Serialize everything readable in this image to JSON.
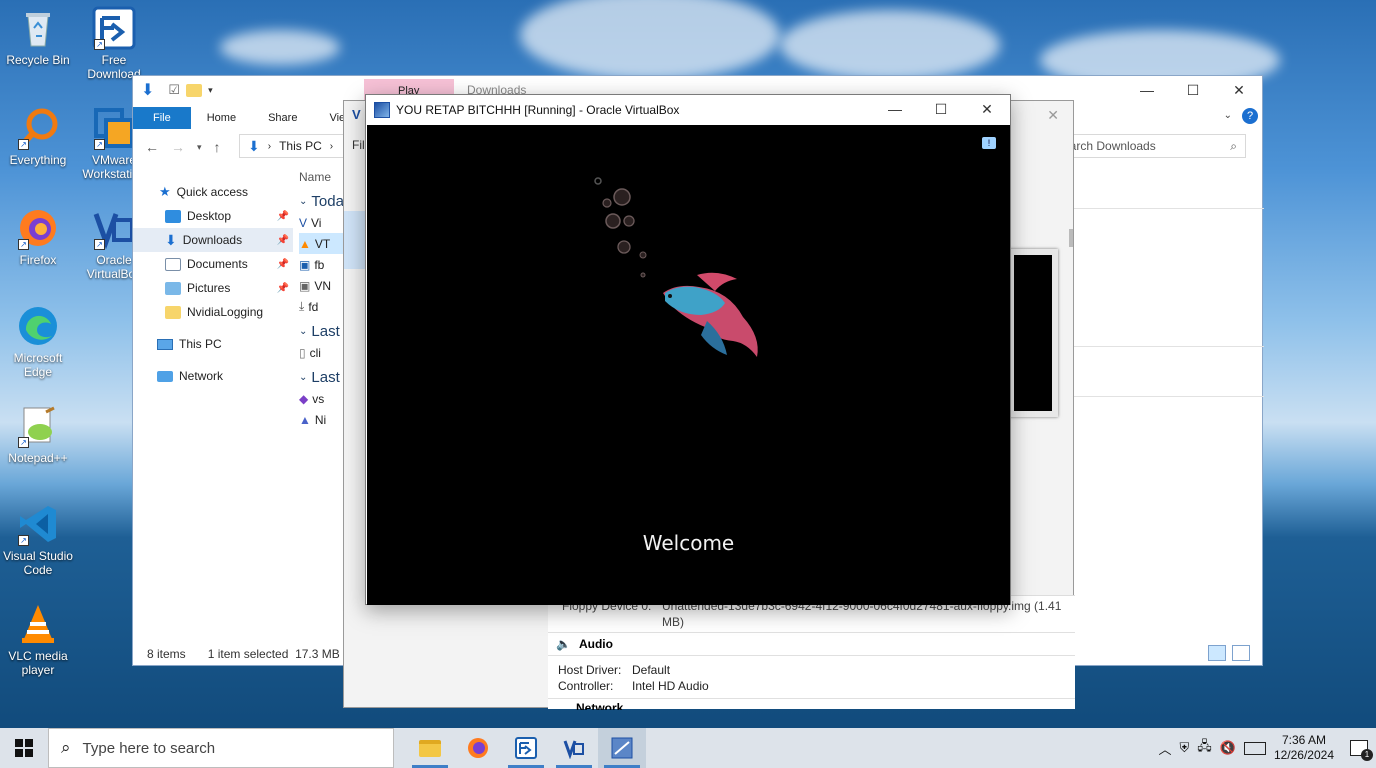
{
  "desktop": {
    "icons": [
      {
        "label": "Recycle Bin"
      },
      {
        "label": "Free Download"
      },
      {
        "label": "Everything"
      },
      {
        "label": "VMware Workstation"
      },
      {
        "label": "Firefox"
      },
      {
        "label": "Oracle VirtualBox"
      },
      {
        "label": "Microsoft Edge"
      },
      {
        "label": "Notepad++"
      },
      {
        "label": "Visual Studio Code"
      },
      {
        "label": "VLC media player"
      }
    ]
  },
  "explorer": {
    "tab_play": "Play",
    "title": "Downloads",
    "ribbon_tabs": [
      "File",
      "Home",
      "Share",
      "View"
    ],
    "address": {
      "root": "This PC"
    },
    "search_placeholder": "Search Downloads",
    "column_name": "Name",
    "groups": [
      "Today",
      "Last",
      "Last"
    ],
    "files": [
      "Vi",
      "VT",
      "fb",
      "VN",
      "fd",
      "cli",
      "vs",
      "Ni"
    ],
    "nav": {
      "quick_access": "Quick access",
      "items": [
        {
          "label": "Desktop"
        },
        {
          "label": "Downloads"
        },
        {
          "label": "Documents"
        },
        {
          "label": "Pictures"
        },
        {
          "label": "NvidiaLogging"
        }
      ],
      "this_pc": "This PC",
      "network": "Network"
    },
    "status": {
      "items": "8 items",
      "selected": "1 item selected",
      "size": "17.3 MB"
    }
  },
  "vbox_manager": {
    "file_menu_partial": "Fil",
    "floppy_label": "Floppy Device 0:",
    "floppy_value": "Unattended-13de7b3c-6942-4f12-9000-06c4f0d27481-aux-floppy.img (1.41 MB)",
    "audio_title": "Audio",
    "host_driver_label": "Host Driver:",
    "host_driver_value": "Default",
    "controller_label": "Controller:",
    "controller_value": "Intel HD Audio",
    "network_title": "Network"
  },
  "vm_window": {
    "title": "YOU RETAP BITCHHH [Running] - Oracle VirtualBox",
    "welcome": "Welcome"
  },
  "taskbar": {
    "search_placeholder": "Type here to search",
    "time": "7:36 AM",
    "date": "12/26/2024",
    "notification_count": "1"
  },
  "colors": {
    "accent": "#1979ca",
    "taskbar": "#dde3ea"
  }
}
